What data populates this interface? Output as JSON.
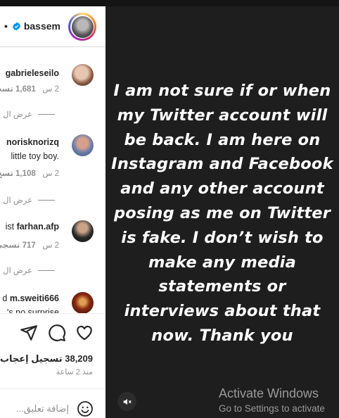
{
  "post": {
    "username": "bassem",
    "verified": true,
    "separator": "•"
  },
  "comments": [
    {
      "user": "gabrieleseilo",
      "text": "",
      "time": "2 س",
      "likes": "1,681",
      "likes_word": "تسجي",
      "replies": "عرض ال"
    },
    {
      "user": "norisknorizq",
      "text": "little toy boy.",
      "time": "2 س",
      "likes": "1,108",
      "likes_word": "تسج",
      "replies": "عرض ال"
    },
    {
      "user": "farhan.afp",
      "text": "ist",
      "time": "2 س",
      "likes": "717",
      "likes_word": "تسجي",
      "replies": "عرض ال"
    },
    {
      "user": "m.sweiti666",
      "text": "d",
      "text2": "'s no surprise",
      "time": "",
      "likes": "",
      "likes_word": "",
      "replies": ""
    }
  ],
  "actions": {
    "like_icon": "heart-icon",
    "comment_icon": "comment-icon",
    "share_icon": "share-icon",
    "likes_count": "38,209",
    "likes_label": "تسجيل إعجاب",
    "time_ago": "منذ 2 ساعة"
  },
  "comment_box": {
    "placeholder": "إضافة تعليق...",
    "emoji_icon": "emoji-icon"
  },
  "story": {
    "text": "I am not sure if or when my Twitter account will be back. I am here on Instagram and Facebook and any other account posing as me on Twitter is fake. I don’t wish to make any media statements or interviews about that now. Thank you",
    "mute_icon": "muted-speaker-icon"
  },
  "watermark": {
    "line1": "Activate Windows",
    "line2": "Go to Settings to activate"
  },
  "colors": {
    "story_bg": "#1e1e1e",
    "panel_bg": "#ffffff",
    "text_primary": "#262626",
    "text_secondary": "#8e8e8e",
    "verified_blue": "#0095f6"
  }
}
